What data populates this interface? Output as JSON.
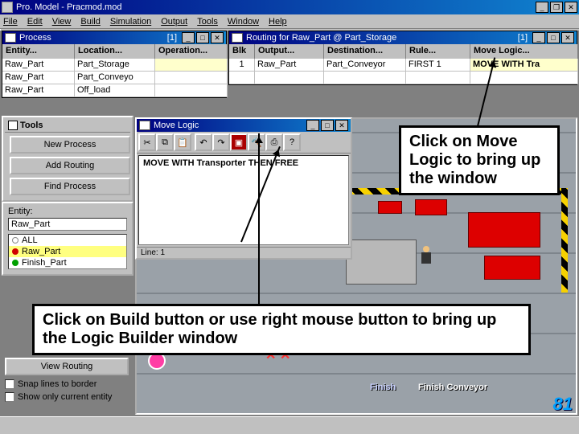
{
  "app": {
    "title": "Pro. Model - Pracmod.mod"
  },
  "menu": [
    "File",
    "Edit",
    "View",
    "Build",
    "Simulation",
    "Output",
    "Tools",
    "Window",
    "Help"
  ],
  "process_win": {
    "title": "Process",
    "index": "[1]",
    "cols": [
      "Entity...",
      "Location...",
      "Operation..."
    ],
    "rows": [
      [
        "Raw_Part",
        "Part_Storage",
        ""
      ],
      [
        "Raw_Part",
        "Part_Conveyo",
        ""
      ],
      [
        "Raw_Part",
        "Off_load",
        ""
      ]
    ]
  },
  "routing_win": {
    "title": "Routing for Raw_Part @ Part_Storage",
    "index": "[1]",
    "cols": [
      "Blk",
      "Output...",
      "Destination...",
      "Rule...",
      "Move Logic..."
    ],
    "rows": [
      [
        "1",
        "Raw_Part",
        "Part_Conveyor",
        "FIRST 1",
        "MOVE WITH Tra"
      ]
    ]
  },
  "tools": {
    "title": "Tools",
    "buttons": [
      "New Process",
      "Add Routing",
      "Find Process"
    ]
  },
  "entity_panel": {
    "label": "Entity:",
    "current": "Raw_Part",
    "items": [
      {
        "name": "ALL",
        "color": null,
        "sel": false
      },
      {
        "name": "Raw_Part",
        "color": "#d00000",
        "sel": true
      },
      {
        "name": "Finish_Part",
        "color": "#00a000",
        "sel": false
      }
    ]
  },
  "move_logic": {
    "title": "Move Logic",
    "code": "MOVE WITH Transporter THEN FREE",
    "status": "Line: 1",
    "tool_icons": [
      "cut-icon",
      "copy-icon",
      "paste-icon",
      "divider",
      "undo-icon",
      "redo-icon",
      "compile-icon",
      "build-icon",
      "print-icon",
      "help-icon"
    ]
  },
  "lower": {
    "view_routing": "View Routing",
    "chk1": "Snap lines to border",
    "chk2": "Show only current entity"
  },
  "layout_labels": {
    "finish": "Finish",
    "finish_conveyor": "Finish Conveyor"
  },
  "callouts": {
    "c1": "Click on Move Logic to bring up the window",
    "c2": "Click on Build button or use right mouse button to bring up the Logic Builder window"
  },
  "page_num": "81"
}
